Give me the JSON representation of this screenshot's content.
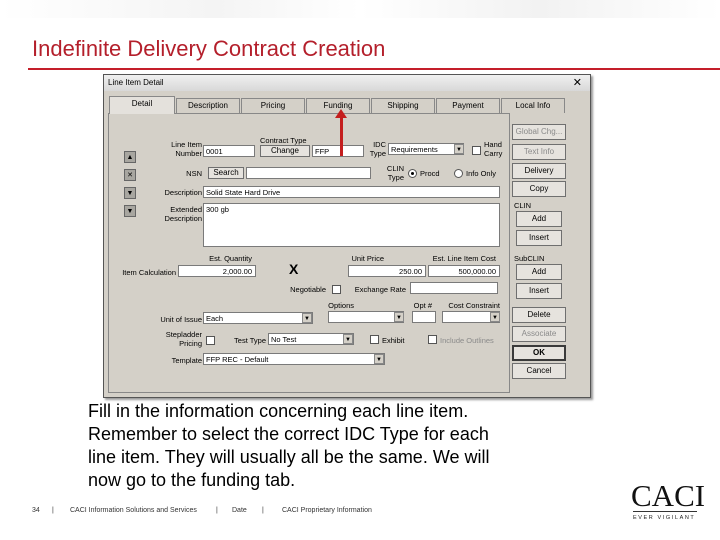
{
  "slide": {
    "title": "Indefinite Delivery Contract Creation",
    "caption_lines": [
      "Fill in the information concerning each line item.",
      "Remember to select the correct IDC Type for each",
      "line item.  They will usually all be the same.  We will",
      "now go to the funding tab."
    ],
    "footer": {
      "page": "34",
      "sep": "|",
      "company": "CACI Information Solutions and Services",
      "date": "Date",
      "proprietary": "CACI Proprietary Information"
    },
    "logo": {
      "text": "CACI",
      "tagline": "EVER VIGILANT"
    }
  },
  "dialog": {
    "title": "Line Item Detail",
    "close": "✕",
    "tabs": [
      "Detail",
      "Description",
      "Pricing",
      "Funding",
      "Shipping",
      "Payment",
      "Local Info"
    ],
    "labels": {
      "line_item": "Line Item",
      "number": "Number",
      "contract_type": "Contract Type",
      "idc": "IDC",
      "type": "Type",
      "hand": "Hand",
      "carry": "Carry",
      "nsn": "NSN",
      "clin": "CLIN",
      "clin_type": "Type",
      "description": "Description",
      "extended": "Extended",
      "extended2": "Description",
      "est_quantity": "Est. Quantity",
      "item_calculation": "Item Calculation",
      "unit_price": "Unit Price",
      "est_line_item_cost": "Est. Line Item Cost",
      "negotiable": "Negotiable",
      "exchange_rate": "Exchange Rate",
      "options": "Options",
      "opt_num": "Opt #",
      "cost_constraint": "Cost Constraint",
      "unit_of_issue": "Unit of Issue",
      "stepladder": "Stepladder",
      "pricing": "Pricing",
      "test_type": "Test Type",
      "exhibit": "Exhibit",
      "include_outlines": "Include Outlines",
      "template": "Template",
      "clin_group": "CLIN",
      "subclin_group": "SubCLIN"
    },
    "values": {
      "line_item_number": "0001",
      "contract_type": "FFP",
      "idc_type": "Requirements",
      "description": "Solid State Hard Drive",
      "extended_description": "300 gb",
      "est_quantity": "2,000.00",
      "unit_price": "250.00",
      "est_line_item_cost": "500,000.00",
      "unit_of_issue": "Each",
      "test_type": "No Test",
      "template": "FFP REC - Default",
      "clin_type_procd": "Procd",
      "clin_type_info": "Info Only",
      "multiply": "X"
    },
    "buttons": {
      "change": "Change",
      "search": "Search",
      "global_chg": "Global Chg...",
      "text_info": "Text Info",
      "delivery": "Delivery",
      "copy": "Copy",
      "clin_add": "Add",
      "clin_insert": "Insert",
      "sub_add": "Add",
      "sub_insert": "Insert",
      "delete": "Delete",
      "associate": "Associate",
      "ok": "OK",
      "cancel": "Cancel"
    },
    "side_icons": [
      "move-up-icon",
      "clear-icon",
      "move-down-icon",
      "move-bottom-icon"
    ],
    "colors": {
      "accent": "#c41e2a",
      "dialog_bg": "#d4d0c8",
      "arrow": "#c41e1e"
    }
  }
}
